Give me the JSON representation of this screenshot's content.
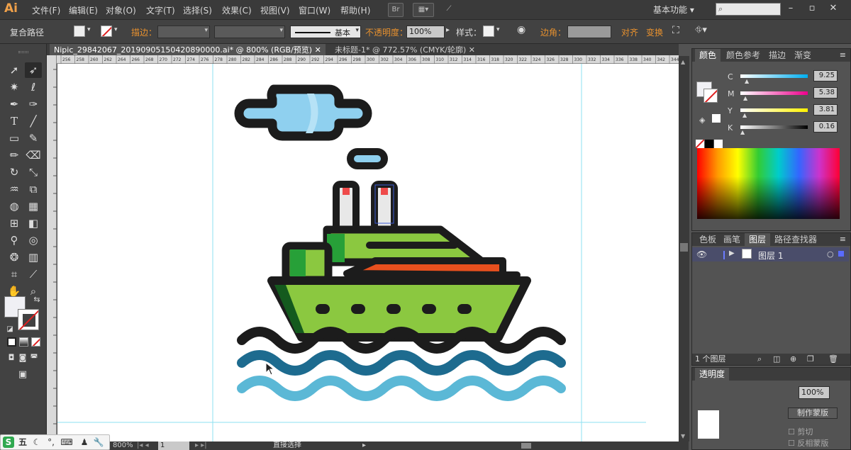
{
  "menubar": {
    "logo": "Ai",
    "items": [
      "文件(F)",
      "编辑(E)",
      "对象(O)",
      "文字(T)",
      "选择(S)",
      "效果(C)",
      "视图(V)",
      "窗口(W)",
      "帮助(H)"
    ],
    "workspace": "基本功能",
    "bridge_label": "Br"
  },
  "controlbar": {
    "selection": "复合路径",
    "stroke_label": "描边：",
    "stroke_style": "基本",
    "opacity_label": "不透明度：",
    "opacity_value": "100%",
    "style_label": "样式：",
    "corner_label": "边角：",
    "align_label": "对齐",
    "transform_label": "变换"
  },
  "tabs": [
    {
      "label": "Nipic_29842067_20190905150420890000.ai* @ 800% (RGB/预览)",
      "active": true
    },
    {
      "label": "未标题-1* @ 772.57% (CMYK/轮廓)",
      "active": false
    }
  ],
  "ruler_ticks": [
    "256",
    "258",
    "260",
    "262",
    "264",
    "266",
    "268",
    "270",
    "272",
    "274",
    "276",
    "278",
    "280",
    "282",
    "284",
    "286",
    "288",
    "290",
    "292",
    "294",
    "296",
    "298",
    "300",
    "302",
    "304",
    "306",
    "308",
    "310",
    "312",
    "314",
    "316",
    "318",
    "320",
    "322",
    "324",
    "326",
    "328",
    "330",
    "332",
    "334",
    "336",
    "338",
    "340",
    "342",
    "344"
  ],
  "color_panel": {
    "tabs": [
      "颜色",
      "颜色参考",
      "描边",
      "渐变"
    ],
    "sliders": [
      {
        "label": "C",
        "value": "9.25",
        "color": "#00aeef"
      },
      {
        "label": "M",
        "value": "5.38",
        "color": "#ec008c"
      },
      {
        "label": "Y",
        "value": "3.81",
        "color": "#fff200"
      },
      {
        "label": "K",
        "value": "0.16",
        "color": "#000000"
      }
    ]
  },
  "layers_panel": {
    "tabs": [
      "色板",
      "画笔",
      "图层",
      "路径查找器"
    ],
    "layer_name": "图层 1",
    "footer_count": "1 个图层"
  },
  "transparency_panel": {
    "tab": "透明度",
    "opacity": "100%",
    "btn_label": "制作蒙版",
    "clip_label": "剪切",
    "invert_label": "反相蒙版"
  },
  "status": {
    "zoom": "800%",
    "page": "1",
    "tool": "直接选择"
  },
  "taskbar": {
    "ime_label": "五"
  },
  "colors": {
    "cloud": "#8fd0ef",
    "hull": "#8bc840",
    "cabin_dark": "#27a038",
    "stripe": "#e8501e",
    "wave_dark": "#1d6b8f",
    "wave_light": "#5bb8d6",
    "outline": "#1c1c1c"
  }
}
